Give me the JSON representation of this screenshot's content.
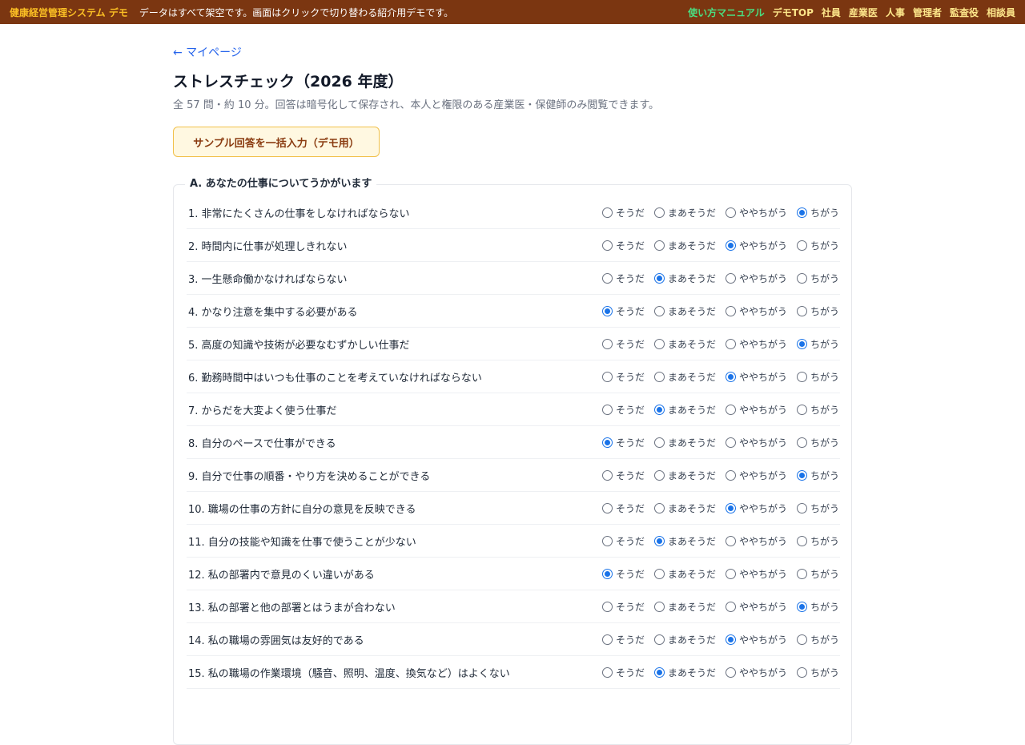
{
  "topbar": {
    "brand": "健康経営管理システム デモ",
    "notice": "データはすべて架空です。画面はクリックで切り替わる紹介用デモです。",
    "nav": [
      "使い方マニュアル",
      "デモTOP",
      "社員",
      "産業医",
      "人事",
      "管理者",
      "監査役",
      "相談員"
    ]
  },
  "page": {
    "back_link": "← マイページ",
    "title": "ストレスチェック（2026 年度）",
    "subtitle": "全 57 問・約 10 分。回答は暗号化して保存され、本人と権限のある産業医・保健師のみ閲覧できます。",
    "demo_button": "サンプル回答を一括入力（デモ用）"
  },
  "section": {
    "legend": "A. あなたの仕事についてうかがいます",
    "options": [
      "そうだ",
      "まあそうだ",
      "ややちがう",
      "ちがう"
    ],
    "questions": [
      {
        "text": "1. 非常にたくさんの仕事をしなければならない",
        "selected": 3
      },
      {
        "text": "2. 時間内に仕事が処理しきれない",
        "selected": 2
      },
      {
        "text": "3. 一生懸命働かなければならない",
        "selected": 1
      },
      {
        "text": "4. かなり注意を集中する必要がある",
        "selected": 0
      },
      {
        "text": "5. 高度の知識や技術が必要なむずかしい仕事だ",
        "selected": 3
      },
      {
        "text": "6. 勤務時間中はいつも仕事のことを考えていなければならない",
        "selected": 2
      },
      {
        "text": "7. からだを大変よく使う仕事だ",
        "selected": 1
      },
      {
        "text": "8. 自分のペースで仕事ができる",
        "selected": 0
      },
      {
        "text": "9. 自分で仕事の順番・やり方を決めることができる",
        "selected": 3
      },
      {
        "text": "10. 職場の仕事の方針に自分の意見を反映できる",
        "selected": 2
      },
      {
        "text": "11. 自分の技能や知識を仕事で使うことが少ない",
        "selected": 1
      },
      {
        "text": "12. 私の部署内で意見のくい違いがある",
        "selected": 0
      },
      {
        "text": "13. 私の部署と他の部署とはうまが合わない",
        "selected": 3
      },
      {
        "text": "14. 私の職場の雰囲気は友好的である",
        "selected": 2
      },
      {
        "text": "15. 私の職場の作業環境（騒音、照明、温度、換気など）はよくない",
        "selected": 1
      }
    ]
  }
}
